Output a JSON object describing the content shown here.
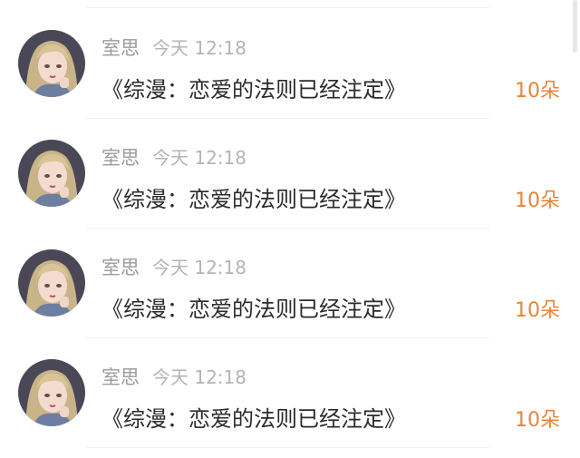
{
  "items": [
    {
      "name": "室思",
      "time": "今天 12:18",
      "title": "《综漫：恋爱的法则已经注定》",
      "count": "10朵",
      "avatar_icon": "user-avatar"
    },
    {
      "name": "室思",
      "time": "今天 12:18",
      "title": "《综漫：恋爱的法则已经注定》",
      "count": "10朵",
      "avatar_icon": "user-avatar"
    },
    {
      "name": "室思",
      "time": "今天 12:18",
      "title": "《综漫：恋爱的法则已经注定》",
      "count": "10朵",
      "avatar_icon": "user-avatar"
    },
    {
      "name": "室思",
      "time": "今天 12:18",
      "title": "《综漫：恋爱的法则已经注定》",
      "count": "10朵",
      "avatar_icon": "user-avatar"
    }
  ],
  "colors": {
    "accent": "#e8843a",
    "name_text": "#9b9b9b",
    "time_text": "#b4b4b4",
    "title_text": "#2b2b2b",
    "divider": "#f1f1f1"
  }
}
